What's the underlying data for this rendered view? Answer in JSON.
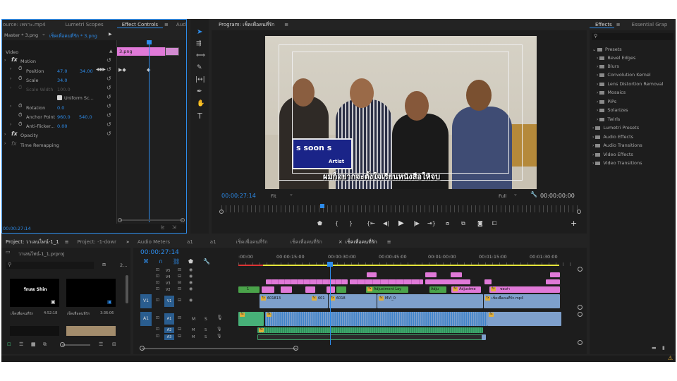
{
  "source_panel": {
    "tabs": [
      "ource: เพราะ.mp4",
      "Lumetri Scopes",
      "Effect Controls",
      "Aud"
    ],
    "active_tab": "Effect Controls",
    "master_label": "Master * 3.png",
    "clip_label": "เช็คเพื่อคนที่รัก * 3.png",
    "timeline_clip": "3.png",
    "video_label": "Video",
    "motion_label": "Motion",
    "position_label": "Position",
    "position_x": "47.0",
    "position_y": "34.00",
    "scale_label": "Scale",
    "scale_value": "34.0",
    "scale_width_label": "Scale Width",
    "scale_width_value": "100.0",
    "uniform_scale_label": "Uniform Sc...",
    "rotation_label": "Rotation",
    "rotation_value": "0.0",
    "anchor_label": "Anchor Point",
    "anchor_x": "960.0",
    "anchor_y": "540.0",
    "antiflicker_label": "Anti-flicker...",
    "antiflicker_value": "0.00",
    "opacity_label": "Opacity",
    "time_remap_label": "Time Remapping",
    "timecode": "00:00:27:14"
  },
  "program_monitor": {
    "title": "Program: เช็คเพื่อคนที่รัก",
    "timecode": "00:00:27:14",
    "fit_label": "Fit",
    "full_label": "Full",
    "duration": "00:00:00:00",
    "lower_third_name": "s soon s",
    "lower_third_role": "Artist",
    "subtitle": "ผมก็อยากจะตั้งใจเรียนหนังสือให้จบ"
  },
  "effects_panel": {
    "tabs": [
      "Effects",
      "Essential Grap"
    ],
    "presets_label": "Presets",
    "preset_items": [
      "Bevel Edges",
      "Blurs",
      "Convolution Kernel",
      "Lens Distortion Removal",
      "Mosaics",
      "PiPs",
      "Solarizes",
      "Twirls"
    ],
    "categories": [
      "Lumetri Presets",
      "Audio Effects",
      "Audio Transitions",
      "Video Effects",
      "Video Transitions"
    ]
  },
  "project_panel": {
    "tabs": [
      "Project: วาเลนไทน์-1_1",
      "Project: -1-dowr"
    ],
    "file_name": "วาเลนไทน์-1_1.prproj",
    "count": "2...",
    "clips": [
      {
        "name": "เช็คเพื่อคนที่รัก",
        "duration": "4:52:18",
        "thumb_text": "รักเลย Shin"
      },
      {
        "name": "เช็คเพื่อคนที่รัก",
        "duration": "3:36:06",
        "thumb_text": ""
      }
    ]
  },
  "timeline": {
    "tabs": [
      "Audio Meters",
      "a1",
      "a1",
      "เช็คเพื่อคนที่รัก",
      "เช็คเพื่อคนที่รัก",
      "เช็คเพื่อคนที่รัก"
    ],
    "active_tab": "เช็คเพื่อคนที่รัก",
    "timecode": "00:00:27:14",
    "ruler": [
      ":00:00",
      "00:00:15:00",
      "00:00:30:00",
      "00:00:45:00",
      "00:01:00:00",
      "00:01:15:00",
      "00:01:30:00"
    ],
    "video_tracks": [
      "V5",
      "V4",
      "V3",
      "V2",
      "V1"
    ],
    "audio_tracks": [
      "A1",
      "A2",
      "A3"
    ],
    "src_v": "V1",
    "src_a": "A1",
    "v2_clips": [
      "1",
      "Adjustment Lay",
      "Adju",
      "Adjustme",
      "ชยเท่า"
    ],
    "v1_clips": [
      "601813",
      "601",
      "6018",
      "MVI_0",
      "เช็คเพื่อคนที่รัก.mp4"
    ],
    "m_label": "M",
    "s_label": "S"
  },
  "colors": {
    "accent": "#2d8ceb",
    "clip_pink": "#e079d8",
    "clip_green": "#4aa34a",
    "clip_blue": "#7ea0cc",
    "audio_green": "#3ea56b",
    "playhead_blue": "#2d8ceb"
  }
}
